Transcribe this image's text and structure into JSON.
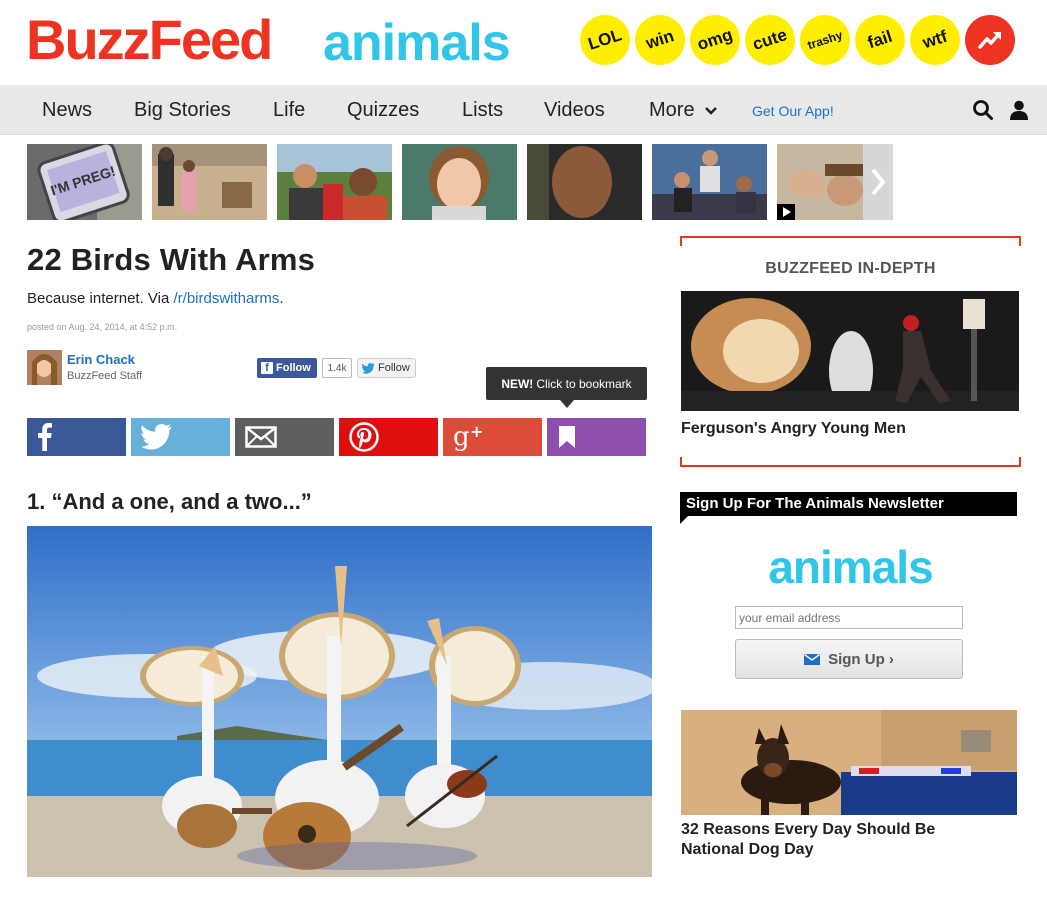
{
  "header": {
    "logo_text": "BuzzFeed",
    "vertical_text": "animals",
    "badges": [
      "LOL",
      "win",
      "omg",
      "cute",
      "trashy",
      "fail",
      "wtf"
    ],
    "trending_icon": "trending-arrow-icon",
    "colors": {
      "logo": "#ee3322",
      "vertical": "#30c6e8",
      "badge": "#ffee00"
    }
  },
  "nav": {
    "items": [
      "News",
      "Big Stories",
      "Life",
      "Quizzes",
      "Lists",
      "Videos",
      "More"
    ],
    "more_icon": "chevron-down-icon",
    "app_link": "Get Our App!",
    "search_icon": "search-icon",
    "user_icon": "user-icon"
  },
  "thumbnails": {
    "first_caption": "I'M PREG!",
    "next_icon": "chevron-right-icon"
  },
  "article": {
    "title": "22 Birds With Arms",
    "dek_prefix": "Because internet. Via ",
    "dek_link": "/r/birdswitharms",
    "dek_suffix": ".",
    "posted": "posted on Aug. 24, 2014, at 4:52 p.m.",
    "author_name": "Erin Chack",
    "author_role": "BuzzFeed Staff",
    "fb_follow": "Follow",
    "fb_count": "1.4k",
    "tw_follow": "Follow",
    "tooltip_bold": "NEW!",
    "tooltip_text": "Click to bookmark",
    "share_buttons": [
      {
        "network": "facebook",
        "color": "#3b5998"
      },
      {
        "network": "twitter",
        "color": "#67b0d9"
      },
      {
        "network": "email",
        "color": "#5e5e5e"
      },
      {
        "network": "pinterest",
        "color": "#e00f0f"
      },
      {
        "network": "google-plus",
        "color": "#dd4b39"
      },
      {
        "network": "bookmark",
        "color": "#8e4ead"
      }
    ],
    "item_1_title": "1. “And a one, and a two...”"
  },
  "sidebar": {
    "indepth_label": "BUZZFEED IN-DEPTH",
    "indepth_caption": "Ferguson's Angry Young Men",
    "newsletter_heading": "Sign Up For The Animals Newsletter",
    "newsletter_logo": "animals",
    "email_placeholder": "your email address",
    "signup_label": "Sign Up ›",
    "promo_caption": "32 Reasons Every Day Should Be National Dog Day"
  }
}
